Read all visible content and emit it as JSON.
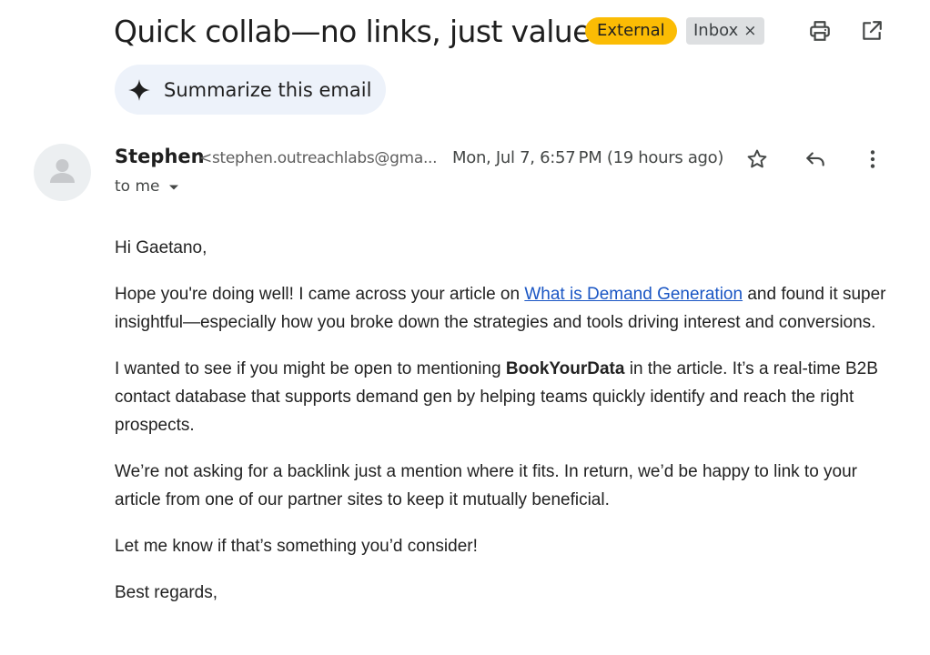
{
  "email": {
    "subject": "Quick collab—no links, just value",
    "labels": {
      "external": "External",
      "inbox": "Inbox",
      "inbox_remove": "×"
    },
    "summarize_label": "Summarize this email",
    "sender": {
      "name": "Stephen",
      "email": "<stephen.outreachlabs@gma...",
      "date": "Mon, Jul 7, 6:57 PM (19 hours ago)",
      "to": "to me"
    },
    "body": {
      "greeting": "Hi Gaetano,",
      "p1_before": "Hope you're doing well! I came across your article on ",
      "p1_link": "What is Demand Generation",
      "p1_after": " and found it super insightful—especially how you broke down the strategies and tools driving interest and conversions.",
      "p2_before": "I wanted to see if you might be open to mentioning ",
      "p2_bold": "BookYourData",
      "p2_after": " in the article. It’s a real-time B2B contact database that supports demand gen by helping teams quickly identify and reach the right prospects.",
      "p3": "We’re not asking for a backlink just a mention where it fits. In return, we’d be happy to link to your article from one of our partner sites to keep it mutually beneficial.",
      "p4": "Let me know if that’s something you’d consider!",
      "closing": "Best regards,"
    }
  },
  "icons": {
    "print": "print-icon",
    "open_new_window": "open-in-new-window-icon",
    "sparkle": "sparkle-icon",
    "avatar": "person-icon",
    "star": "star-icon",
    "reply": "reply-icon",
    "more": "more-vert-icon",
    "dropdown": "caret-down-icon"
  },
  "colors": {
    "external_badge": "#fbbc04",
    "inbox_badge": "#dddfe1",
    "summarize_chip": "#edf2fa",
    "link": "#1a56c4"
  }
}
